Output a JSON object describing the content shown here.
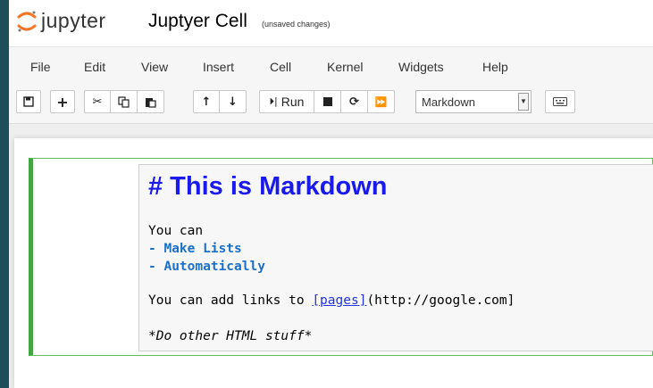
{
  "header": {
    "brand": "jupyter",
    "notebook_title": "Juptyer Cell",
    "save_status": "(unsaved changes)"
  },
  "menu": {
    "items": [
      "File",
      "Edit",
      "View",
      "Insert",
      "Cell",
      "Kernel",
      "Widgets",
      "Help"
    ]
  },
  "toolbar": {
    "run_label": "Run",
    "cell_type": "Markdown",
    "icons": [
      "save-icon",
      "plus-icon",
      "scissors-icon",
      "copy-icon",
      "paste-icon",
      "arrow-up-icon",
      "arrow-down-icon",
      "step-icon",
      "stop-icon",
      "restart-icon",
      "fast-forward-icon",
      "keyboard-icon"
    ]
  },
  "cell": {
    "heading": "# This is Markdown",
    "line_1": "You can",
    "list_1": "- Make Lists",
    "list_2": "- Automatically",
    "link_prefix": "You can add links to ",
    "link_text": "[pages]",
    "link_suffix": "(http://google.com]",
    "italic_line": "*Do other HTML stuff*"
  },
  "colors": {
    "heading": "#1a1aee",
    "list": "#1a6fc9",
    "cell_border": "#42a642",
    "background": "#1d4f5b"
  }
}
